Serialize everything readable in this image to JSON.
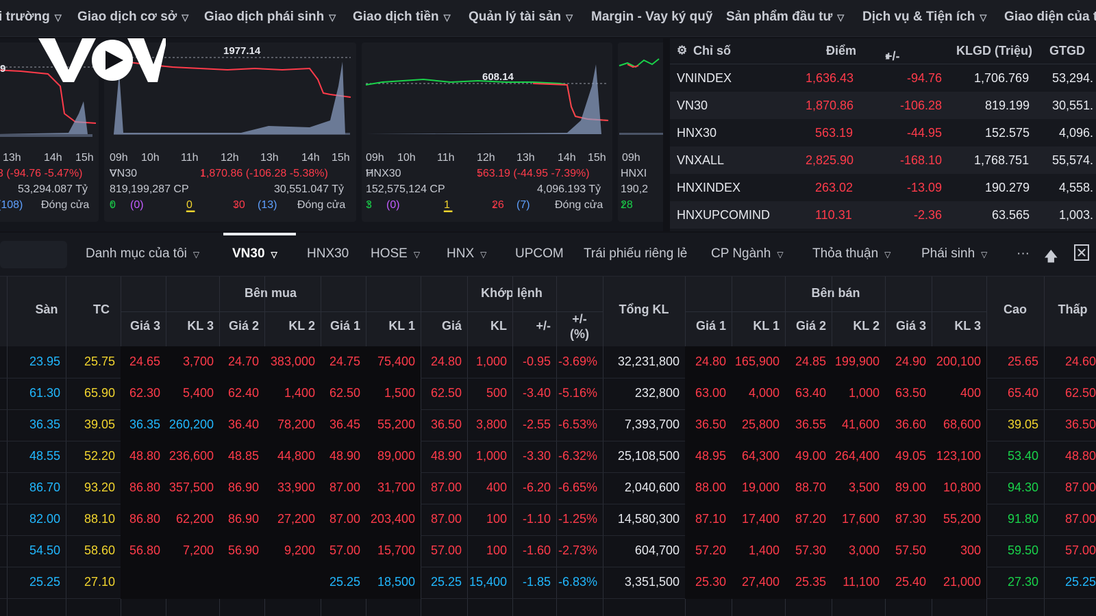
{
  "topnav": {
    "items": [
      {
        "label": "i trường"
      },
      {
        "label": "Giao dịch cơ sở"
      },
      {
        "label": "Giao dịch phái sinh"
      },
      {
        "label": "Giao dịch tiền"
      },
      {
        "label": "Quản lý tài sản"
      },
      {
        "label": "Margin - Vay ký quỹ"
      },
      {
        "label": "Sản phẩm đầu tư"
      },
      {
        "label": "Dịch vụ & Tiện ích"
      },
      {
        "label": "Giao diện của t"
      }
    ]
  },
  "logo": {
    "text": "VOV"
  },
  "cards": [
    {
      "times": [
        "13h",
        "14h",
        "15h"
      ],
      "peak": "",
      "left_edge": "9",
      "line1_right": "3 (-94.76 -5.47%)",
      "line2_right": "53,294.087 Tỷ",
      "line3_left": "(108)",
      "line3_right": "Đóng cửa"
    },
    {
      "times": [
        "09h",
        "10h",
        "11h",
        "12h",
        "13h",
        "14h",
        "15h"
      ],
      "peak": "1977.14",
      "name": "VN30",
      "change": "1,870.86 (-106.28 -5.38%)",
      "volume": "819,199,287 CP",
      "value": "30,551.047 Tỷ",
      "up": "0",
      "up_ceil": "(0)",
      "flat": "0",
      "down": "30",
      "down_floor": "(13)",
      "status": "Đóng cửa"
    },
    {
      "times": [
        "09h",
        "10h",
        "11h",
        "12h",
        "13h",
        "14h",
        "15h"
      ],
      "peak": "608.14",
      "name": "HNX30",
      "change": "563.19 (-44.95 -7.39%)",
      "volume": "152,575,124 CP",
      "value": "4,096.193 Tỷ",
      "up": "3",
      "up_ceil": "(0)",
      "flat": "1",
      "down": "26",
      "down_floor": "(7)",
      "status": "Đóng cửa"
    },
    {
      "times": [
        "09h"
      ],
      "name": "HNXI",
      "volume": "190,2",
      "up": "28"
    }
  ],
  "index_table": {
    "headers": [
      "Chỉ số",
      "Điểm",
      "+/-",
      "KLGD (Triệu)",
      "GTGD"
    ],
    "rows": [
      {
        "name": "VNINDEX",
        "point": "1,636.43",
        "change": "-94.76",
        "vol": "1,706.769",
        "val": "53,294."
      },
      {
        "name": "VN30",
        "point": "1,870.86",
        "change": "-106.28",
        "vol": "819.199",
        "val": "30,551."
      },
      {
        "name": "HNX30",
        "point": "563.19",
        "change": "-44.95",
        "vol": "152.575",
        "val": "4,096."
      },
      {
        "name": "VNXALL",
        "point": "2,825.90",
        "change": "-168.10",
        "vol": "1,768.751",
        "val": "55,574."
      },
      {
        "name": "HNXINDEX",
        "point": "263.02",
        "change": "-13.09",
        "vol": "190.279",
        "val": "4,558."
      },
      {
        "name": "HNXUPCOMINDE",
        "point": "110.31",
        "change": "-2.36",
        "vol": "63.565",
        "val": "1,003."
      }
    ]
  },
  "tabs": {
    "items": [
      {
        "label": "Danh mục của tôi",
        "chevron": true
      },
      {
        "label": "VN30",
        "chevron": true,
        "active": true
      },
      {
        "label": "HNX30",
        "chevron": false
      },
      {
        "label": "HOSE",
        "chevron": true
      },
      {
        "label": "HNX",
        "chevron": true
      },
      {
        "label": "UPCOM",
        "chevron": false
      },
      {
        "label": "Trái phiếu riêng lẻ",
        "chevron": false
      },
      {
        "label": "CP Ngành",
        "chevron": true
      },
      {
        "label": "Thỏa thuận",
        "chevron": true
      },
      {
        "label": "Phái sinh",
        "chevron": true
      }
    ],
    "more": "···"
  },
  "board": {
    "group_headers": {
      "buy": "Bên mua",
      "match": "Khớp lệnh",
      "sell": "Bên bán"
    },
    "headers": {
      "floor": "Sàn",
      "ref": "TC",
      "total": "Tổng KL",
      "high": "Cao",
      "low": "Thấp",
      "buy": [
        "Giá 3",
        "KL 3",
        "Giá 2",
        "KL 2",
        "Giá 1",
        "KL 1"
      ],
      "match": [
        "Giá",
        "KL",
        "+/-",
        "+/-",
        "(%)"
      ],
      "sell": [
        "Giá 1",
        "KL 1",
        "Giá 2",
        "KL 2",
        "Giá 3",
        "KL 3"
      ]
    },
    "rows": [
      {
        "c": [
          "23.95",
          "25.75",
          "24.65",
          "3,700",
          "24.70",
          "383,000",
          "24.75",
          "75,400",
          "24.80",
          "1,000",
          "-0.95",
          "-3.69%",
          "32,231,800",
          "24.80",
          "165,900",
          "24.85",
          "199,900",
          "24.90",
          "200,100",
          "25.65",
          "24.60"
        ],
        "k": [
          "cyan",
          "yellow",
          "red",
          "red",
          "red",
          "red",
          "red",
          "red",
          "red",
          "red",
          "red",
          "red",
          "white",
          "red",
          "red",
          "red",
          "red",
          "red",
          "red",
          "red",
          "red"
        ]
      },
      {
        "c": [
          "61.30",
          "65.90",
          "62.30",
          "5,400",
          "62.40",
          "1,400",
          "62.50",
          "1,500",
          "62.50",
          "500",
          "-3.40",
          "-5.16%",
          "232,800",
          "63.00",
          "4,000",
          "63.40",
          "1,000",
          "63.50",
          "400",
          "65.40",
          "62.50"
        ],
        "k": [
          "cyan",
          "yellow",
          "red",
          "red",
          "red",
          "red",
          "red",
          "red",
          "red",
          "red",
          "red",
          "red",
          "white",
          "red",
          "red",
          "red",
          "red",
          "red",
          "red",
          "red",
          "red"
        ]
      },
      {
        "c": [
          "36.35",
          "39.05",
          "36.35",
          "260,200",
          "36.40",
          "78,200",
          "36.45",
          "55,200",
          "36.50",
          "3,800",
          "-2.55",
          "-6.53%",
          "7,393,700",
          "36.50",
          "25,800",
          "36.55",
          "41,600",
          "36.60",
          "68,600",
          "39.05",
          "36.50"
        ],
        "k": [
          "cyan",
          "yellow",
          "cyan",
          "cyan",
          "red",
          "red",
          "red",
          "red",
          "red",
          "red",
          "red",
          "red",
          "white",
          "red",
          "red",
          "red",
          "red",
          "red",
          "red",
          "yellow",
          "red"
        ]
      },
      {
        "c": [
          "48.55",
          "52.20",
          "48.80",
          "236,600",
          "48.85",
          "44,800",
          "48.90",
          "89,000",
          "48.90",
          "1,000",
          "-3.30",
          "-6.32%",
          "25,108,500",
          "48.95",
          "64,300",
          "49.00",
          "264,400",
          "49.05",
          "123,100",
          "53.40",
          "48.80"
        ],
        "k": [
          "cyan",
          "yellow",
          "red",
          "red",
          "red",
          "red",
          "red",
          "red",
          "red",
          "red",
          "red",
          "red",
          "white",
          "red",
          "red",
          "red",
          "red",
          "red",
          "red",
          "green",
          "red"
        ]
      },
      {
        "c": [
          "86.70",
          "93.20",
          "86.80",
          "357,500",
          "86.90",
          "33,900",
          "87.00",
          "31,700",
          "87.00",
          "400",
          "-6.20",
          "-6.65%",
          "2,040,600",
          "88.00",
          "19,000",
          "88.70",
          "3,500",
          "89.00",
          "10,800",
          "94.30",
          "87.00"
        ],
        "k": [
          "cyan",
          "yellow",
          "red",
          "red",
          "red",
          "red",
          "red",
          "red",
          "red",
          "red",
          "red",
          "red",
          "white",
          "red",
          "red",
          "red",
          "red",
          "red",
          "red",
          "green",
          "red"
        ]
      },
      {
        "c": [
          "82.00",
          "88.10",
          "86.80",
          "62,200",
          "86.90",
          "27,200",
          "87.00",
          "203,400",
          "87.00",
          "100",
          "-1.10",
          "-1.25%",
          "14,580,300",
          "87.10",
          "17,400",
          "87.20",
          "17,600",
          "87.30",
          "55,200",
          "91.80",
          "87.00"
        ],
        "k": [
          "cyan",
          "yellow",
          "red",
          "red",
          "red",
          "red",
          "red",
          "red",
          "red",
          "red",
          "red",
          "red",
          "white",
          "red",
          "red",
          "red",
          "red",
          "red",
          "red",
          "green",
          "red"
        ]
      },
      {
        "c": [
          "54.50",
          "58.60",
          "56.80",
          "7,200",
          "56.90",
          "9,200",
          "57.00",
          "15,700",
          "57.00",
          "100",
          "-1.60",
          "-2.73%",
          "604,700",
          "57.20",
          "1,400",
          "57.30",
          "3,000",
          "57.50",
          "300",
          "59.50",
          "57.00"
        ],
        "k": [
          "cyan",
          "yellow",
          "red",
          "red",
          "red",
          "red",
          "red",
          "red",
          "red",
          "red",
          "red",
          "red",
          "white",
          "red",
          "red",
          "red",
          "red",
          "red",
          "red",
          "green",
          "red"
        ]
      },
      {
        "c": [
          "25.25",
          "27.10",
          "",
          "",
          "",
          "",
          "25.25",
          "18,500",
          "25.25",
          "15,400",
          "-1.85",
          "-6.83%",
          "3,351,500",
          "25.30",
          "27,400",
          "25.35",
          "11,100",
          "25.40",
          "21,000",
          "27.30",
          "25.25"
        ],
        "k": [
          "cyan",
          "yellow",
          "red",
          "red",
          "red",
          "red",
          "cyan",
          "cyan",
          "cyan",
          "cyan",
          "cyan",
          "cyan",
          "white",
          "red",
          "red",
          "red",
          "red",
          "red",
          "red",
          "green",
          "cyan"
        ]
      }
    ]
  },
  "colors": {
    "red": "#ff3b4a",
    "green": "#19d34a",
    "yellow": "#f2d52e",
    "cyan": "#21b8ff",
    "purple": "#c25cff"
  }
}
